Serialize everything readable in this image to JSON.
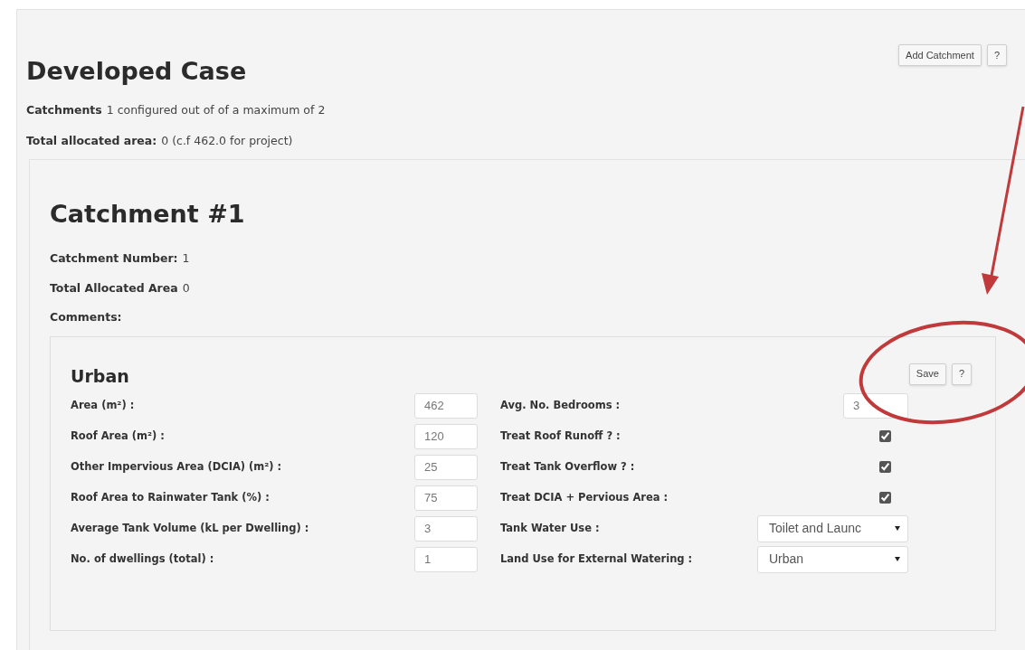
{
  "header": {
    "title": "Developed Case",
    "buttons": [
      "Add Catchment",
      "?"
    ]
  },
  "summary": [
    {
      "label": "Catchments",
      "text": "1 configured out of of a maximum of 2"
    },
    {
      "label": "Total allocated area:",
      "text": "0 (c.f 462.0 for project)"
    }
  ],
  "catchment": {
    "title": "Catchment #1",
    "details": [
      {
        "label": "Catchment Number:",
        "text": "1"
      },
      {
        "label": "Total Allocated Area",
        "text": "0"
      },
      {
        "label": "Comments:"
      }
    ]
  },
  "urban": {
    "title": "Urban",
    "buttons": [
      "Save",
      "?"
    ],
    "left_fields": [
      {
        "label": "Area (m²) :",
        "value": "462"
      },
      {
        "label": "Roof Area (m²) :",
        "value": "120"
      },
      {
        "label": "Other Impervious Area (DCIA) (m²) :",
        "value": "25"
      },
      {
        "label": "Roof Area to Rainwater Tank (%) :",
        "value": "75"
      },
      {
        "label": "Average Tank Volume (kL per Dwelling) :",
        "value": "3"
      },
      {
        "label": "No. of dwellings (total) :",
        "value": "1"
      }
    ],
    "right_fields": [
      {
        "kind": "number",
        "label": "Avg. No. Bedrooms :",
        "value": "3"
      },
      {
        "kind": "checkbox",
        "label": "Treat Roof Runoff ? :",
        "checked": true
      },
      {
        "kind": "checkbox",
        "label": "Treat Tank Overflow ? :",
        "checked": true
      },
      {
        "kind": "checkbox",
        "label": "Treat DCIA + Pervious Area :",
        "checked": true
      },
      {
        "kind": "select",
        "label": "Tank Water Use :",
        "value": "Toilet and Launc"
      },
      {
        "kind": "select",
        "label": "Land Use for External Watering :",
        "value": "Urban"
      }
    ]
  }
}
